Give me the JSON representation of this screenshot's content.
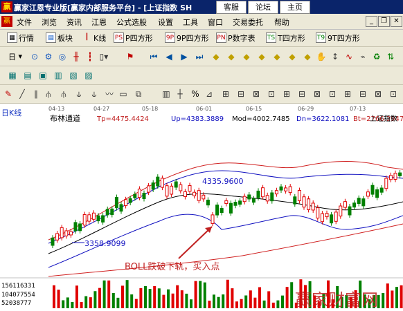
{
  "window": {
    "title": "赢家江恩专业版[赢家内部服务平台] - [上证指数  SH",
    "buttons": [
      "客服",
      "论坛",
      "主页"
    ]
  },
  "menu": {
    "items": [
      "文件",
      "浏览",
      "资讯",
      "江恩",
      "公式选股",
      "设置",
      "工具",
      "窗口",
      "交易委托",
      "帮助"
    ]
  },
  "toolbar1": {
    "items": [
      "行情",
      "板块",
      "K线",
      "P四方形",
      "9P四方形",
      "P数字表",
      "T四方形",
      "9T四方形"
    ],
    "icon_labels": [
      "PS",
      "9P",
      "PN",
      "TS",
      "T9"
    ]
  },
  "toolbar2": {
    "items": [
      "日"
    ]
  },
  "chart": {
    "period_label": "日K线",
    "dates": [
      "04-13",
      "04-27",
      "05-18",
      "06-01",
      "06-15",
      "06-29",
      "07-13"
    ],
    "indicator": {
      "name": "布林通道",
      "tp": "Tp=4475.4424",
      "up": "Up=4383.3889",
      "mod": "Mod=4002.7485",
      "dn": "Dn=3622.1081",
      "bt": "Bt=2766.2947"
    },
    "index_name": "上证指数",
    "high_label": "4335.9600",
    "low_label": "3358.9099",
    "annotation": "BOLL跌破下轨，买入点",
    "volume_labels": [
      "156116331",
      "104077554",
      "52038777"
    ],
    "watermark": "赢家财富网",
    "colors": {
      "up": "#e00000",
      "down": "#008000",
      "band": "#1010c0",
      "mid": "#000000",
      "outer": "#d02020"
    }
  },
  "chart_data": {
    "type": "line",
    "title": "布林通道",
    "x": [
      "04-13",
      "04-27",
      "05-18",
      "06-01",
      "06-15",
      "06-29",
      "07-13"
    ],
    "series": [
      {
        "name": "Tp",
        "values": [
          4475.4424
        ]
      },
      {
        "name": "Up",
        "values": [
          4383.3889
        ]
      },
      {
        "name": "Mod",
        "values": [
          4002.7485
        ]
      },
      {
        "name": "Dn",
        "values": [
          3622.1081
        ]
      },
      {
        "name": "Bt",
        "values": [
          2766.2947
        ]
      }
    ],
    "annotations": [
      "4335.9600",
      "3358.9099",
      "BOLL跌破下轨，买入点"
    ]
  }
}
